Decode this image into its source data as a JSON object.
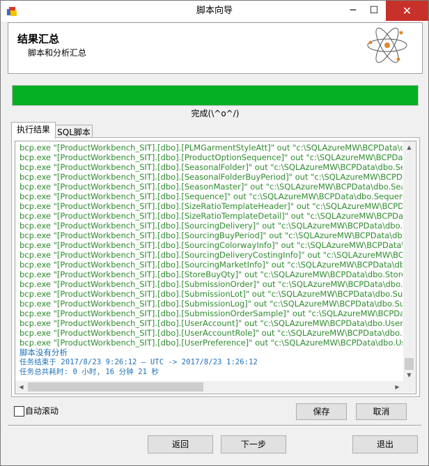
{
  "window": {
    "title": "脚本向导",
    "minimize_glyph": "─",
    "maximize_glyph": "☐",
    "close_glyph": "✕"
  },
  "header": {
    "title": "结果汇总",
    "subtitle": "脚本和分析汇总",
    "logo_icon": "atom-icon"
  },
  "progress": {
    "value_percent": 100,
    "fill_color": "#06b025",
    "status_text": "完成(\\^o^/)"
  },
  "tabs": [
    {
      "label": "执行结果",
      "active": true
    },
    {
      "label": "SQL脚本",
      "active": false
    }
  ],
  "output": {
    "colors": {
      "command": "#2e8b2e",
      "info": "#1c6fb8"
    },
    "lines": [
      "bcp.exe \"[ProductWorkbench_SIT].[dbo].[PLMGarmentStyleAtt]\" out \"c:\\SQLAzureMW\\BCPData\\dbo",
      "bcp.exe \"[ProductWorkbench_SIT].[dbo].[ProductOptionSequence]\" out \"c:\\SQLAzureMW\\BCPData",
      "bcp.exe \"[ProductWorkbench_SIT].[dbo].[SeasonalFolder]\" out \"c:\\SQLAzureMW\\BCPData\\dbo.Seas",
      "bcp.exe \"[ProductWorkbench_SIT].[dbo].[SeasonalFolderBuyPeriod]\" out \"c:\\SQLAzureMW\\BCPData\\",
      "bcp.exe \"[ProductWorkbench_SIT].[dbo].[SeasonMaster]\" out \"c:\\SQLAzureMW\\BCPData\\dbo.Seaso",
      "bcp.exe \"[ProductWorkbench_SIT].[dbo].[Sequence]\" out \"c:\\SQLAzureMW\\BCPData\\dbo.Sequence",
      "bcp.exe \"[ProductWorkbench_SIT].[dbo].[SizeRatioTemplateHeader]\" out \"c:\\SQLAzureMW\\BCPData",
      "bcp.exe \"[ProductWorkbench_SIT].[dbo].[SizeRatioTemplateDetail]\" out \"c:\\SQLAzureMW\\BCPData",
      "bcp.exe \"[ProductWorkbench_SIT].[dbo].[SourcingDelivery]\" out \"c:\\SQLAzureMW\\BCPData\\dbo.So",
      "bcp.exe \"[ProductWorkbench_SIT].[dbo].[SourcingBuyPeriod]\" out \"c:\\SQLAzureMW\\BCPData\\dbo.S",
      "bcp.exe \"[ProductWorkbench_SIT].[dbo].[SourcingColorwayInfo]\" out \"c:\\SQLAzureMW\\BCPData\\d",
      "bcp.exe \"[ProductWorkbench_SIT].[dbo].[SourcingDeliveryCostingInfo]\" out \"c:\\SQLAzureMW\\BCPD",
      "bcp.exe \"[ProductWorkbench_SIT].[dbo].[SourcingMarketInfo]\" out \"c:\\SQLAzureMW\\BCPData\\dbo",
      "bcp.exe \"[ProductWorkbench_SIT].[dbo].[StoreBuyQty]\" out \"c:\\SQLAzureMW\\BCPData\\dbo.Store",
      "bcp.exe \"[ProductWorkbench_SIT].[dbo].[SubmissionOrder]\" out \"c:\\SQLAzureMW\\BCPData\\dbo.Su",
      "bcp.exe \"[ProductWorkbench_SIT].[dbo].[SubmissionLot]\" out \"c:\\SQLAzureMW\\BCPData\\dbo.Sub",
      "bcp.exe \"[ProductWorkbench_SIT].[dbo].[SubmissionLog]\" out \"c:\\SQLAzureMW\\BCPData\\dbo.Sub",
      "bcp.exe \"[ProductWorkbench_SIT].[dbo].[SubmissionOrderSample]\" out \"c:\\SQLAzureMW\\BCPData\\",
      "bcp.exe \"[ProductWorkbench_SIT].[dbo].[UserAccount]\" out \"c:\\SQLAzureMW\\BCPData\\dbo.UserA",
      "bcp.exe \"[ProductWorkbench_SIT].[dbo].[UserAccountRole]\" out \"c:\\SQLAzureMW\\BCPData\\dbo.Use",
      "bcp.exe \"[ProductWorkbench_SIT].[dbo].[UserPreference]\" out \"c:\\SQLAzureMW\\BCPData\\dbo.Us"
    ],
    "no_analysis": "脚本没有分析",
    "finished": "任务结束于 2017/8/23 9:26:12 — UTC -> 2017/8/23 1:26:12",
    "elapsed": "任务总共耗时: 0 小时, 16 分钟 21 秒"
  },
  "auto_scroll": {
    "label": "自动滚动",
    "checked": false
  },
  "buttons": {
    "save": "保存",
    "cancel": "取消",
    "back": "返回",
    "next": "下一步",
    "exit": "退出"
  }
}
